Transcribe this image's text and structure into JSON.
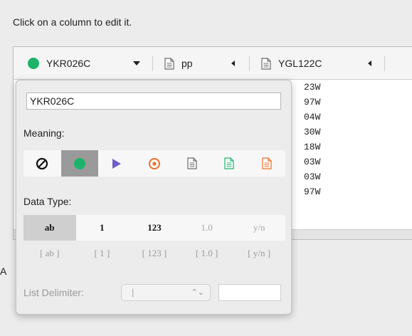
{
  "instruction": "Click on a column to edit it.",
  "columns": [
    {
      "name": "YKR026C",
      "type": "dot",
      "color": "#1db36b",
      "indicator": "dropdown"
    },
    {
      "name": "pp",
      "type": "doc",
      "color": "#6b6b6b",
      "indicator": "collapse"
    },
    {
      "name": "YGL122C",
      "type": "doc",
      "color": "#6b6b6b",
      "indicator": "collapse"
    }
  ],
  "rows": [
    "23W",
    "97W",
    "04W",
    "30W",
    "18W",
    "03W",
    "03W",
    "97W"
  ],
  "stray_char": "A",
  "popover": {
    "name_value": "YKR026C",
    "meaning_label": "Meaning:",
    "meaning_options": [
      {
        "icon": "none-icon",
        "color": "#111111"
      },
      {
        "icon": "circle-icon",
        "color": "#1db36b",
        "selected": true
      },
      {
        "icon": "triangle-icon",
        "color": "#6e5fc7"
      },
      {
        "icon": "target-icon",
        "color": "#e8702a"
      },
      {
        "icon": "doc-icon",
        "color": "#6b6b6b"
      },
      {
        "icon": "doc-icon",
        "color": "#1db36b"
      },
      {
        "icon": "doc-icon",
        "color": "#e8702a"
      }
    ],
    "data_type_label": "Data Type:",
    "data_types_single": [
      "ab",
      "1",
      "123",
      "1.0",
      "y/n"
    ],
    "data_types_list": [
      "[ ab ]",
      "[ 1 ]",
      "[ 123 ]",
      "[ 1.0 ]",
      "[ y/n ]"
    ],
    "list_delimiter_label": "List Delimiter:",
    "list_delimiter_value": "|"
  }
}
